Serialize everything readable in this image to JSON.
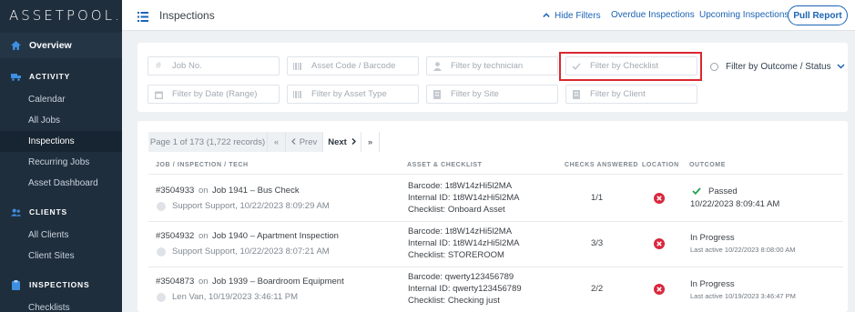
{
  "sidebar": {
    "logo": "ASSETPOOL.",
    "overview": "Overview",
    "sections": [
      {
        "title": "ACTIVITY",
        "items": [
          "Calendar",
          "All Jobs",
          "Inspections",
          "Recurring Jobs",
          "Asset Dashboard"
        ]
      },
      {
        "title": "CLIENTS",
        "items": [
          "All Clients",
          "Client Sites"
        ]
      },
      {
        "title": "INSPECTIONS",
        "items": [
          "Checklists"
        ]
      }
    ],
    "active_item": "Inspections"
  },
  "topbar": {
    "title": "Inspections",
    "hide_filters": "Hide Filters",
    "overdue": "Overdue Inspections",
    "upcoming": "Upcoming Inspections",
    "pull_report": "Pull Report"
  },
  "filters": {
    "job_no": "Job No.",
    "asset_code": "Asset Code / Barcode",
    "technician": "Filter by technician",
    "checklist": "Filter by Checklist",
    "outcome": "Filter by Outcome / Status",
    "date": "Filter by Date (Range)",
    "asset_type": "Filter by Asset Type",
    "site": "Filter by Site",
    "client": "Filter by Client"
  },
  "pager": {
    "info": "Page 1 of 173 (1,722 records)",
    "first": "«",
    "prev": "Prev",
    "next": "Next",
    "last": "»"
  },
  "table": {
    "headers": [
      "JOB / INSPECTION / TECH",
      "ASSET & CHECKLIST",
      "CHECKS ANSWERED",
      "LOCATION",
      "OUTCOME"
    ],
    "rows": [
      {
        "id": "#3504933",
        "on": "on",
        "job": "Job 1941 – Bus Check",
        "tech": "Support Support, 10/22/2023 8:09:29 AM",
        "barcode": "Barcode: 1t8W14zHi5l2MA",
        "internal_id": "Internal ID: 1t8W14zHi5l2MA",
        "checklist": "Checklist: Onboard Asset",
        "checks": "1/1",
        "outcome": "Passed",
        "outcome_time": "10/22/2023 8:09:41 AM"
      },
      {
        "id": "#3504932",
        "on": "on",
        "job": "Job 1940 – Apartment Inspection",
        "tech": "Support Support, 10/22/2023 8:07:21 AM",
        "barcode": "Barcode: 1t8W14zHi5l2MA",
        "internal_id": "Internal ID: 1t8W14zHi5l2MA",
        "checklist": "Checklist: STOREROOM",
        "checks": "3/3",
        "outcome": "In Progress",
        "outcome_time": "Last active 10/22/2023 8:08:00 AM"
      },
      {
        "id": "#3504873",
        "on": "on",
        "job": "Job 1939 – Boardroom Equipment",
        "tech": "Len Van, 10/19/2023 3:46:11 PM",
        "barcode": "Barcode: qwerty123456789",
        "internal_id": "Internal ID: qwerty123456789",
        "checklist": "Checklist: Checking just",
        "checks": "2/2",
        "outcome": "In Progress",
        "outcome_time": "Last active 10/19/2023 3:46:47 PM"
      }
    ]
  },
  "colors": {
    "sidebar_bg": "#1f2e3d",
    "link": "#1b63b5",
    "passed": "#22a04b",
    "fail_icon": "#d9283e",
    "highlight": "#d9282f"
  }
}
